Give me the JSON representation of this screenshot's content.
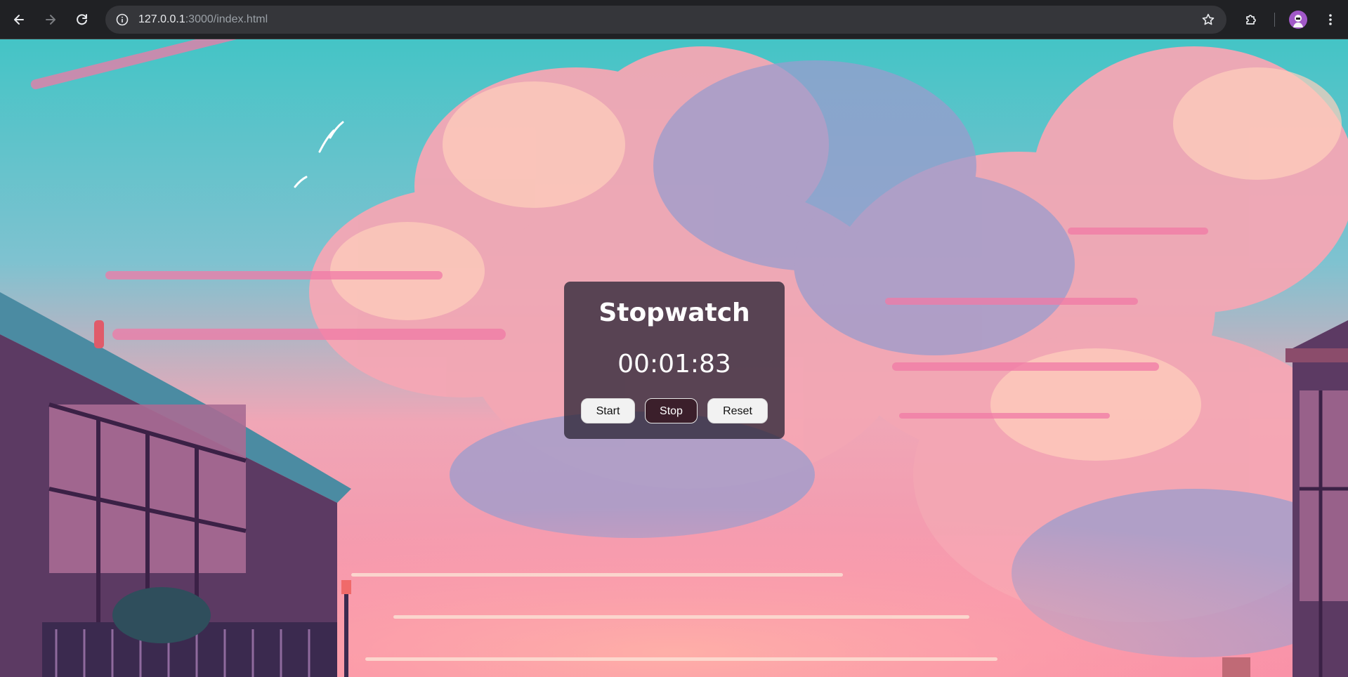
{
  "browser": {
    "url_host": "127.0.0.1",
    "url_path": ":3000/index.html",
    "icons": {
      "back": "back-arrow-icon",
      "forward": "forward-arrow-icon",
      "reload": "reload-icon",
      "site_info": "info-icon",
      "bookmark": "star-icon",
      "extensions": "puzzle-icon",
      "menu": "kebab-menu-icon"
    }
  },
  "stopwatch": {
    "title": "Stopwatch",
    "time": "00:01:83",
    "buttons": {
      "start": "Start",
      "stop": "Stop",
      "reset": "Reset"
    }
  },
  "colors": {
    "toolbar_bg": "#202124",
    "omnibox_bg": "#35363a",
    "card_bg": "rgba(45,38,55,0.78)",
    "stop_button_bg": "#3b1f2b",
    "avatar_bg": "#8e44ad"
  }
}
